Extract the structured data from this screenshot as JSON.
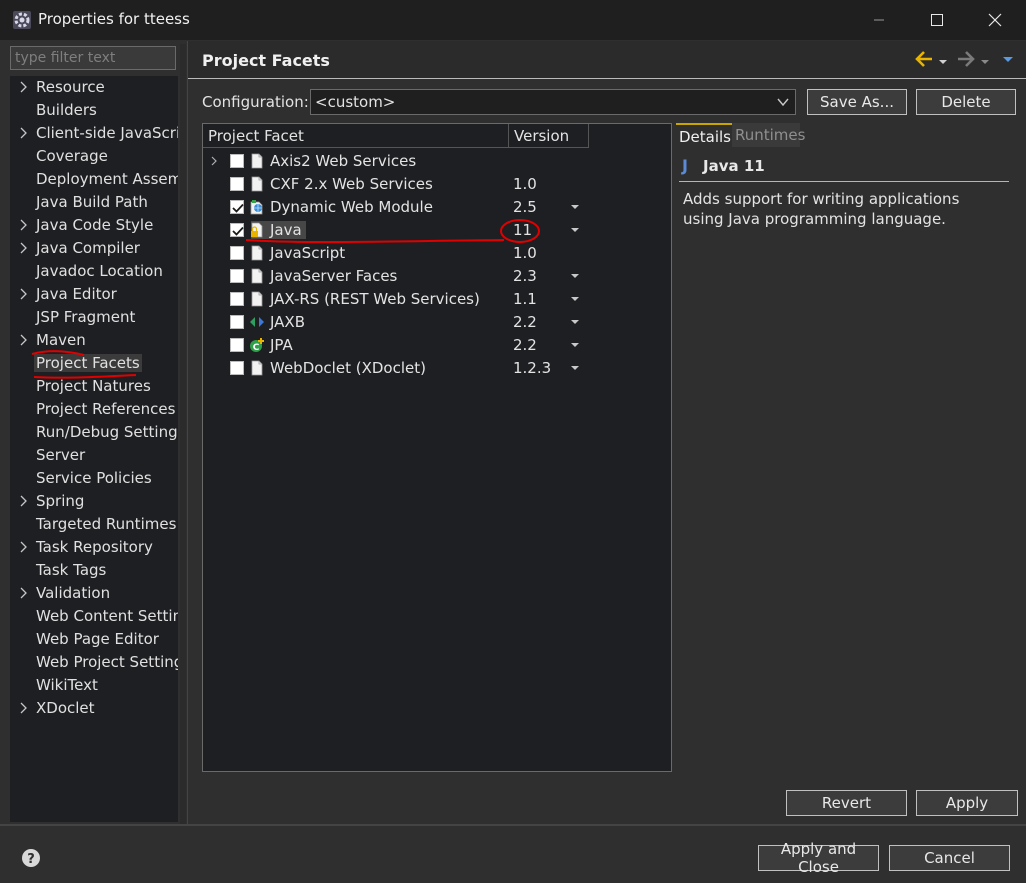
{
  "window": {
    "title": "Properties for tteess"
  },
  "filter": {
    "placeholder": "type filter text"
  },
  "tree": [
    {
      "label": "Resource",
      "expandable": true
    },
    {
      "label": "Builders",
      "expandable": false
    },
    {
      "label": "Client-side JavaScript",
      "expandable": true
    },
    {
      "label": "Coverage",
      "expandable": false
    },
    {
      "label": "Deployment Assembly",
      "expandable": false
    },
    {
      "label": "Java Build Path",
      "expandable": false
    },
    {
      "label": "Java Code Style",
      "expandable": true
    },
    {
      "label": "Java Compiler",
      "expandable": true
    },
    {
      "label": "Javadoc Location",
      "expandable": false
    },
    {
      "label": "Java Editor",
      "expandable": true
    },
    {
      "label": "JSP Fragment",
      "expandable": false
    },
    {
      "label": "Maven",
      "expandable": true
    },
    {
      "label": "Project Facets",
      "expandable": false,
      "selected": true
    },
    {
      "label": "Project Natures",
      "expandable": false
    },
    {
      "label": "Project References",
      "expandable": false
    },
    {
      "label": "Run/Debug Settings",
      "expandable": false
    },
    {
      "label": "Server",
      "expandable": false
    },
    {
      "label": "Service Policies",
      "expandable": false
    },
    {
      "label": "Spring",
      "expandable": true
    },
    {
      "label": "Targeted Runtimes",
      "expandable": false
    },
    {
      "label": "Task Repository",
      "expandable": true
    },
    {
      "label": "Task Tags",
      "expandable": false
    },
    {
      "label": "Validation",
      "expandable": true
    },
    {
      "label": "Web Content Settings",
      "expandable": false
    },
    {
      "label": "Web Page Editor",
      "expandable": false
    },
    {
      "label": "Web Project Settings",
      "expandable": false
    },
    {
      "label": "WikiText",
      "expandable": false
    },
    {
      "label": "XDoclet",
      "expandable": true
    }
  ],
  "page": {
    "title": "Project Facets",
    "config_label": "Configuration:",
    "config_value": "<custom>",
    "save_as_label": "Save As...",
    "delete_label": "Delete"
  },
  "facets": {
    "col_facet": "Project Facet",
    "col_version": "Version",
    "rows": [
      {
        "name": "Axis2 Web Services",
        "version": "",
        "checked": false,
        "expandable": true,
        "dropdown": false,
        "icon": "file-icon"
      },
      {
        "name": "CXF 2.x Web Services",
        "version": "1.0",
        "checked": false,
        "expandable": false,
        "dropdown": false,
        "icon": "file-icon"
      },
      {
        "name": "Dynamic Web Module",
        "version": "2.5",
        "checked": true,
        "expandable": false,
        "dropdown": true,
        "icon": "web-module-icon"
      },
      {
        "name": "Java",
        "version": "11",
        "checked": true,
        "expandable": false,
        "dropdown": true,
        "icon": "java-lock-icon",
        "selected": true
      },
      {
        "name": "JavaScript",
        "version": "1.0",
        "checked": false,
        "expandable": false,
        "dropdown": false,
        "icon": "file-icon"
      },
      {
        "name": "JavaServer Faces",
        "version": "2.3",
        "checked": false,
        "expandable": false,
        "dropdown": true,
        "icon": "file-icon"
      },
      {
        "name": "JAX-RS (REST Web Services)",
        "version": "1.1",
        "checked": false,
        "expandable": false,
        "dropdown": true,
        "icon": "file-icon"
      },
      {
        "name": "JAXB",
        "version": "2.2",
        "checked": false,
        "expandable": false,
        "dropdown": true,
        "icon": "jaxb-icon"
      },
      {
        "name": "JPA",
        "version": "2.2",
        "checked": false,
        "expandable": false,
        "dropdown": true,
        "icon": "jpa-icon"
      },
      {
        "name": "WebDoclet (XDoclet)",
        "version": "1.2.3",
        "checked": false,
        "expandable": false,
        "dropdown": true,
        "icon": "file-icon"
      }
    ]
  },
  "details": {
    "tab_details": "Details",
    "tab_runtimes": "Runtimes",
    "icon_glyph": "J",
    "title": "Java 11",
    "description": "Adds support for writing applications using Java programming language."
  },
  "buttons": {
    "revert": "Revert",
    "apply": "Apply",
    "apply_close": "Apply and Close",
    "cancel": "Cancel"
  },
  "colors": {
    "accent_nav": "#e8b400",
    "annotation_red": "#e00000"
  }
}
